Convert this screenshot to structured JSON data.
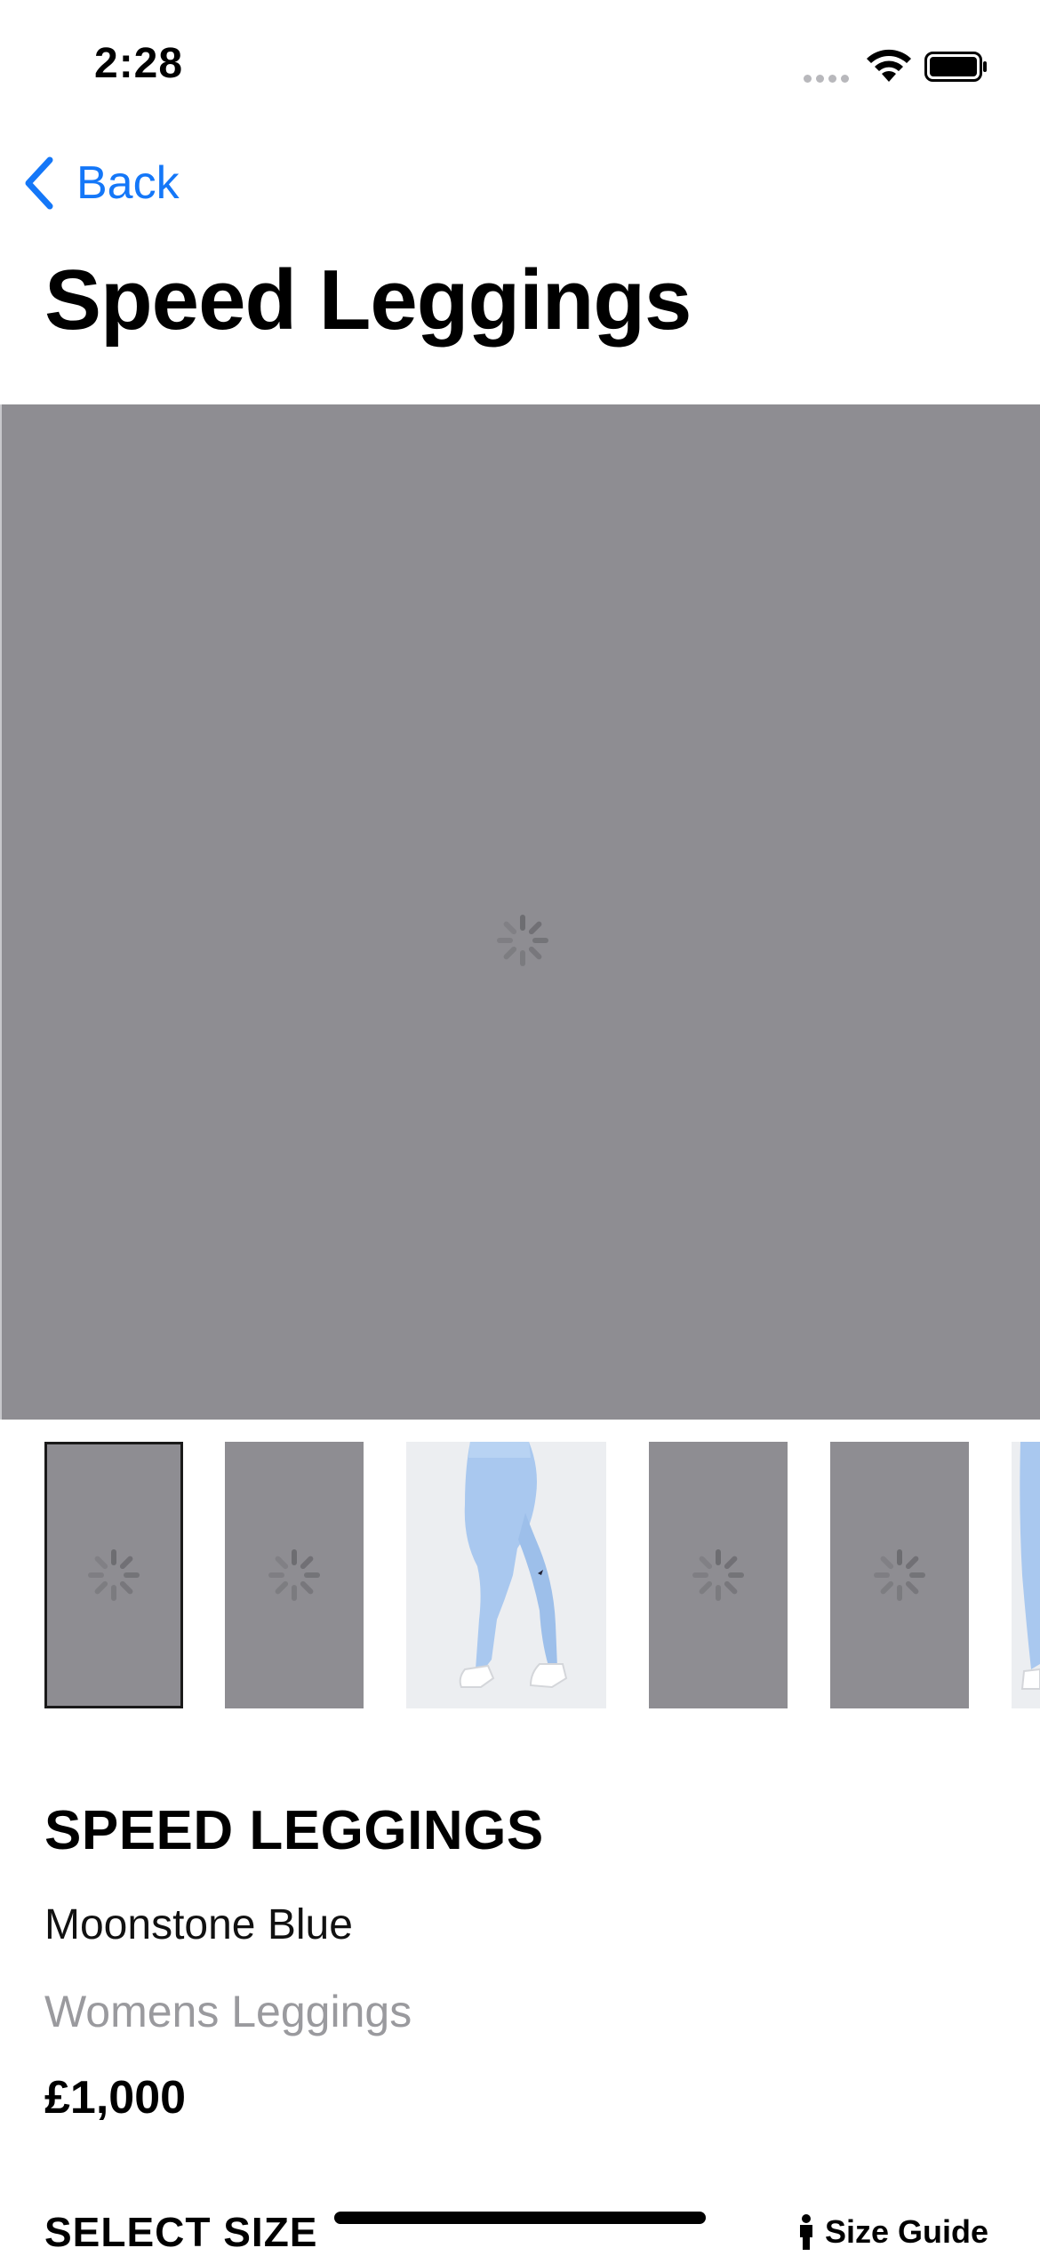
{
  "status_bar": {
    "time": "2:28"
  },
  "nav": {
    "back_label": "Back",
    "title": "Speed Leggings"
  },
  "gallery": {
    "thumbnail_count": 6,
    "selected_index": 0
  },
  "product": {
    "name": "SPEED LEGGINGS",
    "color": "Moonstone Blue",
    "category": "Womens Leggings",
    "price": "£1,000"
  },
  "size_section": {
    "heading": "SELECT SIZE",
    "guide_label": "Size Guide"
  },
  "colors": {
    "accent": "#1477f8",
    "placeholder_gray": "#8e8d92",
    "secondary_text": "#9a9a9e",
    "leggings_blue": "#a9c8ef"
  },
  "icons": [
    "back-chevron-icon",
    "wifi-icon",
    "battery-icon",
    "cellular-icon",
    "loading-spinner-icon",
    "person-icon"
  ]
}
